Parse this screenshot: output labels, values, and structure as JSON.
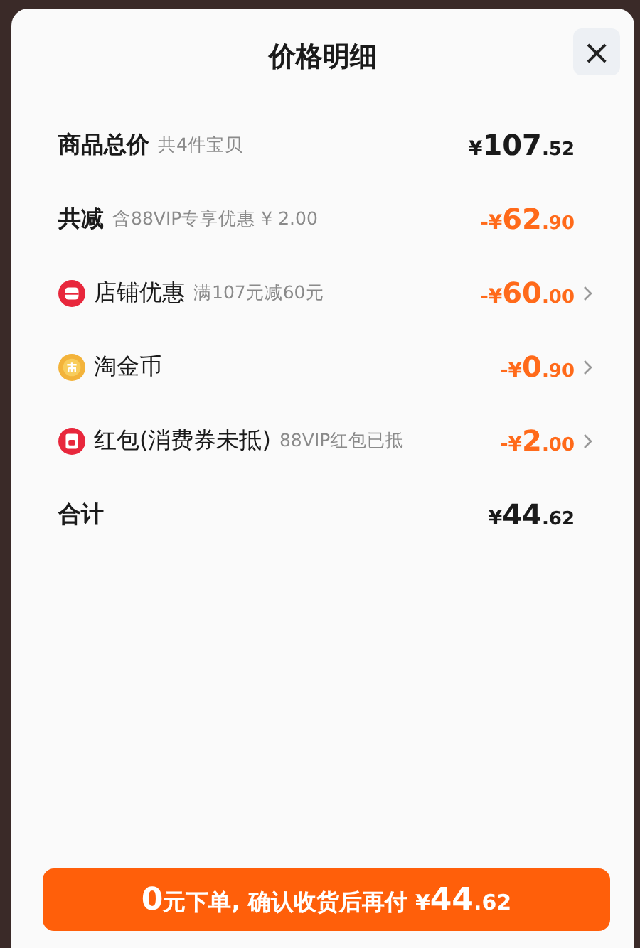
{
  "title": "价格明细",
  "close": "×",
  "rows": [
    {
      "kind": "heading",
      "label": "商品总价",
      "note": "共4件宝贝",
      "sign": "¥",
      "whole": "107",
      "cents": ".52",
      "discount": false,
      "chevron": false
    },
    {
      "kind": "heading",
      "label": "共减",
      "note": "含88VIP专享优惠 ¥ 2.00",
      "sign": "-¥",
      "whole": "62",
      "cents": ".90",
      "discount": true,
      "chevron": false
    },
    {
      "kind": "store",
      "label": "店铺优惠",
      "note": "满107元减60元",
      "sign": "-¥",
      "whole": "60",
      "cents": ".00",
      "discount": true,
      "chevron": true
    },
    {
      "kind": "coin",
      "label": "淘金币",
      "sign": "-¥",
      "whole": "0",
      "cents": ".90",
      "discount": true,
      "chevron": true
    },
    {
      "kind": "packet",
      "label": "红包(消费券未抵)",
      "note": "88VIP红包已抵",
      "sign": "-¥",
      "whole": "2",
      "cents": ".00",
      "discount": true,
      "chevron": true
    },
    {
      "kind": "total",
      "label": "合计",
      "sign": "¥",
      "whole": "44",
      "cents": ".62",
      "discount": false,
      "chevron": false
    }
  ],
  "pay_button": {
    "lead": "0",
    "text": "元下单, 确认收货后再付 ",
    "sign": "¥",
    "whole": "44",
    "cents": ".62"
  }
}
